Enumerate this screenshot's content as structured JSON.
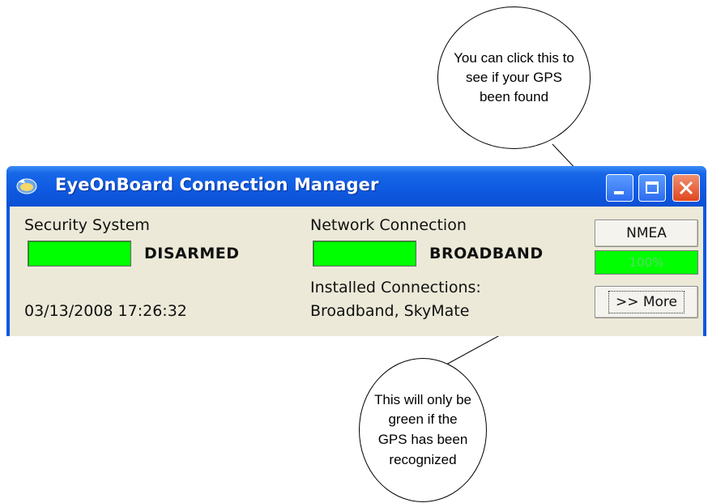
{
  "window": {
    "title": "EyeOnBoard Connection Manager"
  },
  "security": {
    "label": "Security System",
    "status": "DISARMED",
    "indicator_color": "#00ff00"
  },
  "network": {
    "label": "Network Connection",
    "status": "BROADBAND",
    "indicator_color": "#00ff00",
    "installed_label": "Installed Connections:",
    "installed_value": "Broadband, SkyMate"
  },
  "timestamp": "03/13/2008 17:26:32",
  "gps": {
    "button_label": "NMEA",
    "signal_percent": "100%",
    "indicator_color": "#00ff00"
  },
  "more_button_label": ">> More",
  "callouts": {
    "top": "You can click this to see if your GPS been found",
    "bottom": "This will only be green if the GPS has been recognized"
  }
}
